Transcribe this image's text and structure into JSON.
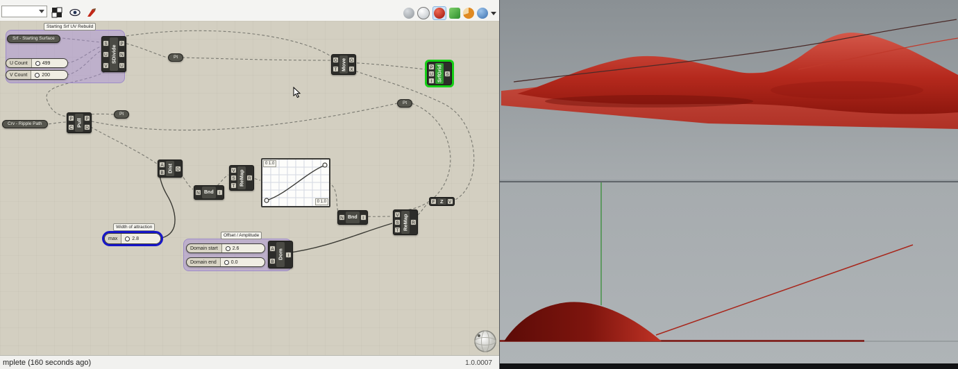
{
  "toolbar": {
    "dropdown_value": "",
    "left_icons": [
      "checker-grid",
      "preview-eye",
      "paint-brush"
    ],
    "right_icons": [
      "preview-off",
      "preview-wireframe",
      "preview-shaded",
      "preview-custom",
      "profiler",
      "remote-control"
    ]
  },
  "canvas": {
    "groups": {
      "uv_rebuild": {
        "label": "Starting Srf UV Rebuild"
      },
      "offset_amplitude": {
        "label": "Offset / Amplitude"
      }
    },
    "tags": {
      "width_of_attraction": "Width of attraction"
    },
    "params": {
      "srf": "Srf - Starting Surface",
      "crv": "Crv - Ripple Path",
      "pt": "Pt"
    },
    "sliders": {
      "u_count": {
        "label": "U Count",
        "value": "499"
      },
      "v_count": {
        "label": "V Count",
        "value": "200"
      },
      "max": {
        "label": "max",
        "value": "2.8"
      },
      "domain_start": {
        "label": "Domain start",
        "value": "2.6"
      },
      "domain_end": {
        "label": "Domain end",
        "value": "0.0"
      }
    },
    "components": {
      "sdivide": {
        "label": "SDivide",
        "inputs": [
          "S",
          "U",
          "V"
        ],
        "outputs": [
          "P",
          "N",
          "U"
        ]
      },
      "move": {
        "label": "Move",
        "inputs": [
          "G",
          "T"
        ],
        "outputs": [
          "G",
          "X"
        ]
      },
      "srfgrid": {
        "label": "SrfGrid",
        "inputs": [
          "P",
          "U",
          "I"
        ],
        "outputs": [
          "S"
        ]
      },
      "pull": {
        "label": "Pull",
        "inputs": [
          "P",
          "C"
        ],
        "outputs": [
          "P",
          "D"
        ]
      },
      "dist": {
        "label": "Dist",
        "inputs": [
          "A",
          "B"
        ],
        "outputs": [
          "D"
        ]
      },
      "bnd1": {
        "label": "Bnd",
        "inputs": [
          "N"
        ],
        "outputs": [
          "I"
        ]
      },
      "remap1": {
        "label": "ReMap",
        "inputs": [
          "V",
          "S",
          "T"
        ],
        "outputs": [
          "R"
        ]
      },
      "bnd2": {
        "label": "Bnd",
        "inputs": [
          "N"
        ],
        "outputs": [
          "I"
        ]
      },
      "remap2": {
        "label": "ReMap",
        "inputs": [
          "V",
          "S",
          "T"
        ],
        "outputs": [
          "R"
        ]
      },
      "unitz": {
        "label": "Z",
        "inputs": [
          "F"
        ],
        "outputs": [
          "V"
        ]
      },
      "dom": {
        "label": "Dom",
        "inputs": [
          "A",
          "B"
        ],
        "outputs": [
          "I"
        ]
      }
    },
    "graph_mapper": {
      "tag_top": "0 1.0",
      "tag_bottom": "0 1.0"
    }
  },
  "statusbar": {
    "left": "mplete (160 seconds ago)",
    "right": "1.0.0007"
  },
  "colors": {
    "selection_green": "#17cf17",
    "selection_blue": "#1717c9",
    "group_purple": "#a78fd6",
    "surface_red": "#c0392b",
    "canvas_bg": "#d3cfc1"
  }
}
